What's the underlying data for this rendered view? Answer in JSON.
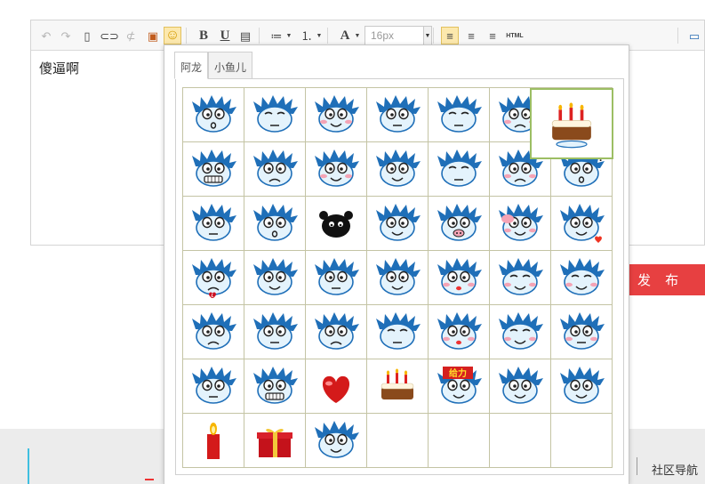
{
  "toolbar": {
    "buttons": [
      {
        "name": "undo-icon",
        "glyph": "↶",
        "enabled": false
      },
      {
        "name": "redo-icon",
        "glyph": "↷",
        "enabled": false
      },
      {
        "name": "new-document-icon",
        "glyph": "▯",
        "enabled": true
      },
      {
        "name": "link-icon",
        "glyph": "⊂⊃",
        "enabled": true
      },
      {
        "name": "unlink-icon",
        "glyph": "⊄",
        "enabled": false
      },
      {
        "name": "insert-image-icon",
        "glyph": "▣",
        "enabled": true
      },
      {
        "name": "emoticon-icon",
        "glyph": "☺",
        "enabled": true
      },
      {
        "name": "bold-icon",
        "glyph": "B",
        "enabled": true
      },
      {
        "name": "underline-icon",
        "glyph": "U",
        "enabled": true
      },
      {
        "name": "paste-icon",
        "glyph": "▤",
        "enabled": true
      },
      {
        "name": "bullet-list-icon",
        "glyph": "≔",
        "enabled": true
      },
      {
        "name": "numbered-list-icon",
        "glyph": "⒈",
        "enabled": true
      },
      {
        "name": "font-color-icon",
        "glyph": "A",
        "enabled": true
      },
      {
        "name": "align-left-icon",
        "glyph": "≡",
        "enabled": true
      },
      {
        "name": "align-center-icon",
        "glyph": "≡",
        "enabled": true
      },
      {
        "name": "align-right-icon",
        "glyph": "≡",
        "enabled": true
      },
      {
        "name": "html-source-icon",
        "glyph": "HTML",
        "enabled": true
      },
      {
        "name": "fullscreen-icon",
        "glyph": "▭",
        "enabled": true
      }
    ],
    "font_size_value": "16px"
  },
  "editor": {
    "content_text": "傻逼啊"
  },
  "emoticon_panel": {
    "tabs": [
      {
        "label": "阿龙",
        "active": true
      },
      {
        "label": "小鱼儿",
        "active": false
      }
    ],
    "selected_index": 6,
    "emoticons": [
      {
        "name": "dragon-surprised-icon",
        "mouth": "o",
        "blush": false,
        "prop": ""
      },
      {
        "name": "dragon-calm-icon",
        "mouth": "flat",
        "blush": false,
        "prop": ""
      },
      {
        "name": "dragon-shy-icon",
        "mouth": "smile",
        "blush": true,
        "prop": ""
      },
      {
        "name": "dragon-thinking-icon",
        "mouth": "flat",
        "blush": false,
        "prop": ""
      },
      {
        "name": "dragon-bored-icon",
        "mouth": "flat",
        "blush": false,
        "prop": ""
      },
      {
        "name": "dragon-angry-icon",
        "mouth": "frown",
        "blush": true,
        "prop": ""
      },
      {
        "name": "dragon-birthday-cake-icon",
        "mouth": "none",
        "blush": false,
        "prop": "cake"
      },
      {
        "name": "dragon-grinning-teeth-icon",
        "mouth": "teeth",
        "blush": false,
        "prop": ""
      },
      {
        "name": "dragon-worried-icon",
        "mouth": "frown",
        "blush": false,
        "prop": ""
      },
      {
        "name": "dragon-smug-icon",
        "mouth": "smile",
        "blush": true,
        "prop": ""
      },
      {
        "name": "dragon-wink-icon",
        "mouth": "smile",
        "blush": false,
        "prop": ""
      },
      {
        "name": "dragon-sleepy-icon",
        "mouth": "flat",
        "blush": false,
        "prop": ""
      },
      {
        "name": "dragon-furious-icon",
        "mouth": "frown",
        "blush": true,
        "prop": ""
      },
      {
        "name": "dragon-confused-icon",
        "mouth": "o",
        "blush": false,
        "prop": "question"
      },
      {
        "name": "dragon-staring-icon",
        "mouth": "flat",
        "blush": false,
        "prop": ""
      },
      {
        "name": "dragon-dizzy-icon",
        "mouth": "o",
        "blush": false,
        "prop": ""
      },
      {
        "name": "black-sheep-icon",
        "mouth": "none",
        "blush": false,
        "prop": "sheep"
      },
      {
        "name": "dragon-waving-icon",
        "mouth": "smile",
        "blush": false,
        "prop": ""
      },
      {
        "name": "dragon-pig-nose-icon",
        "mouth": "pig",
        "blush": false,
        "prop": ""
      },
      {
        "name": "dragon-couple-hug-icon",
        "mouth": "smile",
        "blush": true,
        "prop": "couple"
      },
      {
        "name": "dragon-love-icon",
        "mouth": "smile",
        "blush": false,
        "prop": "heart"
      },
      {
        "name": "dragon-heartbroken-icon",
        "mouth": "frown",
        "blush": false,
        "prop": "brokenheart"
      },
      {
        "name": "dragon-thumbs-up-icon",
        "mouth": "smile",
        "blush": false,
        "prop": ""
      },
      {
        "name": "dragon-thumbs-down-icon",
        "mouth": "flat",
        "blush": false,
        "prop": ""
      },
      {
        "name": "dragon-cheeky-icon",
        "mouth": "smile",
        "blush": false,
        "prop": ""
      },
      {
        "name": "dragon-kiss-icon",
        "mouth": "kiss",
        "blush": true,
        "prop": ""
      },
      {
        "name": "dragon-laughing-icon",
        "mouth": "smile",
        "blush": true,
        "prop": ""
      },
      {
        "name": "dragon-content-icon",
        "mouth": "smile",
        "blush": true,
        "prop": ""
      },
      {
        "name": "dragon-crying-icon",
        "mouth": "frown",
        "blush": false,
        "prop": ""
      },
      {
        "name": "dragon-lying-icon",
        "mouth": "flat",
        "blush": false,
        "prop": ""
      },
      {
        "name": "dragon-annoyed-icon",
        "mouth": "frown",
        "blush": false,
        "prop": ""
      },
      {
        "name": "dragon-squint-icon",
        "mouth": "flat",
        "blush": false,
        "prop": ""
      },
      {
        "name": "dragon-lips-icon",
        "mouth": "kiss",
        "blush": true,
        "prop": ""
      },
      {
        "name": "dragon-blush-icon",
        "mouth": "smile",
        "blush": true,
        "prop": ""
      },
      {
        "name": "dragon-eye-roll-icon",
        "mouth": "flat",
        "blush": true,
        "prop": ""
      },
      {
        "name": "dragon-fainted-icon",
        "mouth": "flat",
        "blush": false,
        "prop": ""
      },
      {
        "name": "dragon-fist-icon",
        "mouth": "teeth",
        "blush": false,
        "prop": ""
      },
      {
        "name": "red-heart-icon",
        "mouth": "none",
        "blush": false,
        "prop": "bigheart"
      },
      {
        "name": "birthday-cake-icon",
        "mouth": "none",
        "blush": false,
        "prop": "cakeonly"
      },
      {
        "name": "dragon-geili-sign-icon",
        "mouth": "smile",
        "blush": false,
        "prop": "sign"
      },
      {
        "name": "dragon-grin-icon",
        "mouth": "smile",
        "blush": false,
        "prop": ""
      },
      {
        "name": "dragon-big-laugh-icon",
        "mouth": "smile",
        "blush": false,
        "prop": ""
      },
      {
        "name": "candle-icon",
        "mouth": "none",
        "blush": false,
        "prop": "candle"
      },
      {
        "name": "gift-box-icon",
        "mouth": "none",
        "blush": false,
        "prop": "gift"
      },
      {
        "name": "dragon-victory-icon",
        "mouth": "smile",
        "blush": false,
        "prop": ""
      }
    ],
    "empty_cells": 4,
    "geili_sign_text": "给力",
    "colors": {
      "dragon_blue": "#1f6fb8",
      "face": "#e4f3fc",
      "blush": "#f4a3b5",
      "grid_border": "#c4c4a4",
      "selected_border": "#9cbe63"
    }
  },
  "publish_button": {
    "label": "发 布",
    "color": "#e74041"
  },
  "footer": {
    "community_nav_label": "社区导航"
  }
}
